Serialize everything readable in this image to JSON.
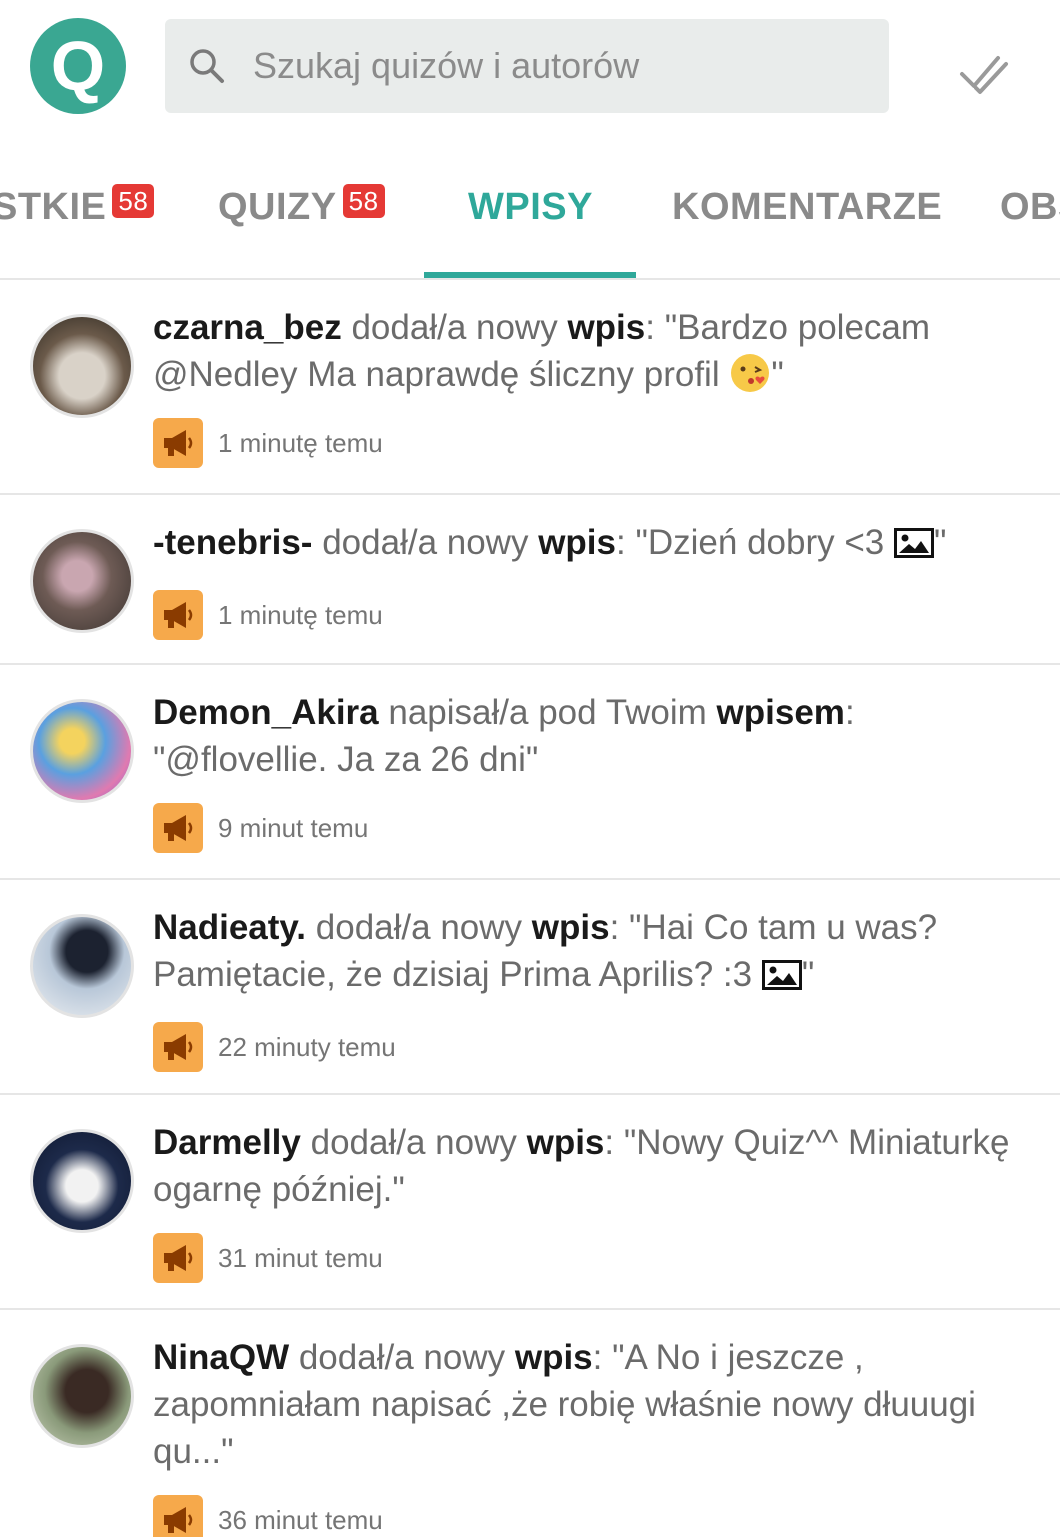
{
  "header": {
    "logo_letter": "Q",
    "search_placeholder": "Szukaj quizów i autorów"
  },
  "tabs": [
    {
      "label": "STKIE",
      "badge": "58"
    },
    {
      "label": "QUIZY",
      "badge": "58"
    },
    {
      "label": "WPISY",
      "active": true
    },
    {
      "label": "KOMENTARZE"
    },
    {
      "label": "OBS"
    }
  ],
  "feed": [
    {
      "user": "czarna_bez",
      "action": "dodał/a nowy",
      "keyword": "wpis",
      "text_before": "\"Bardzo polecam @Nedley Ma naprawdę śliczny profil ",
      "text_after": "\"",
      "time": "1 minutę temu"
    },
    {
      "user": "-tenebris-",
      "action": "dodał/a nowy",
      "keyword": "wpis",
      "text_before": "\"Dzień dobry <3 ",
      "text_after": "\"",
      "time": "1 minutę temu"
    },
    {
      "user": "Demon_Akira",
      "action": "napisał/a pod Twoim",
      "keyword": "wpisem",
      "text_before": "\"@flovellie. Ja za 26 dni\"",
      "text_after": "",
      "time": "9 minut temu"
    },
    {
      "user": "Nadieaty.",
      "action": "dodał/a nowy",
      "keyword": "wpis",
      "text_before": "\"Hai Co tam u was? Pamiętacie, że dzisiaj Prima Aprilis? :3 ",
      "text_after": "\"",
      "time": "22 minuty temu"
    },
    {
      "user": "Darmelly",
      "action": "dodał/a nowy",
      "keyword": "wpis",
      "text_before": "\"Nowy Quiz^^ Miniaturkę ogarnę później.\"",
      "text_after": "",
      "time": "31 minut temu"
    },
    {
      "user": "NinaQW",
      "action": "dodał/a nowy",
      "keyword": "wpis",
      "text_before": "\"A No i jeszcze , zapomniałam napisać ,że robię właśnie nowy dłuuugi qu...\"",
      "text_after": "",
      "time": "36 minut temu"
    }
  ],
  "colors": {
    "accent": "#2fa89a",
    "logo": "#3aa792",
    "badge": "#e53935",
    "notification_icon": "#f6a94b"
  }
}
